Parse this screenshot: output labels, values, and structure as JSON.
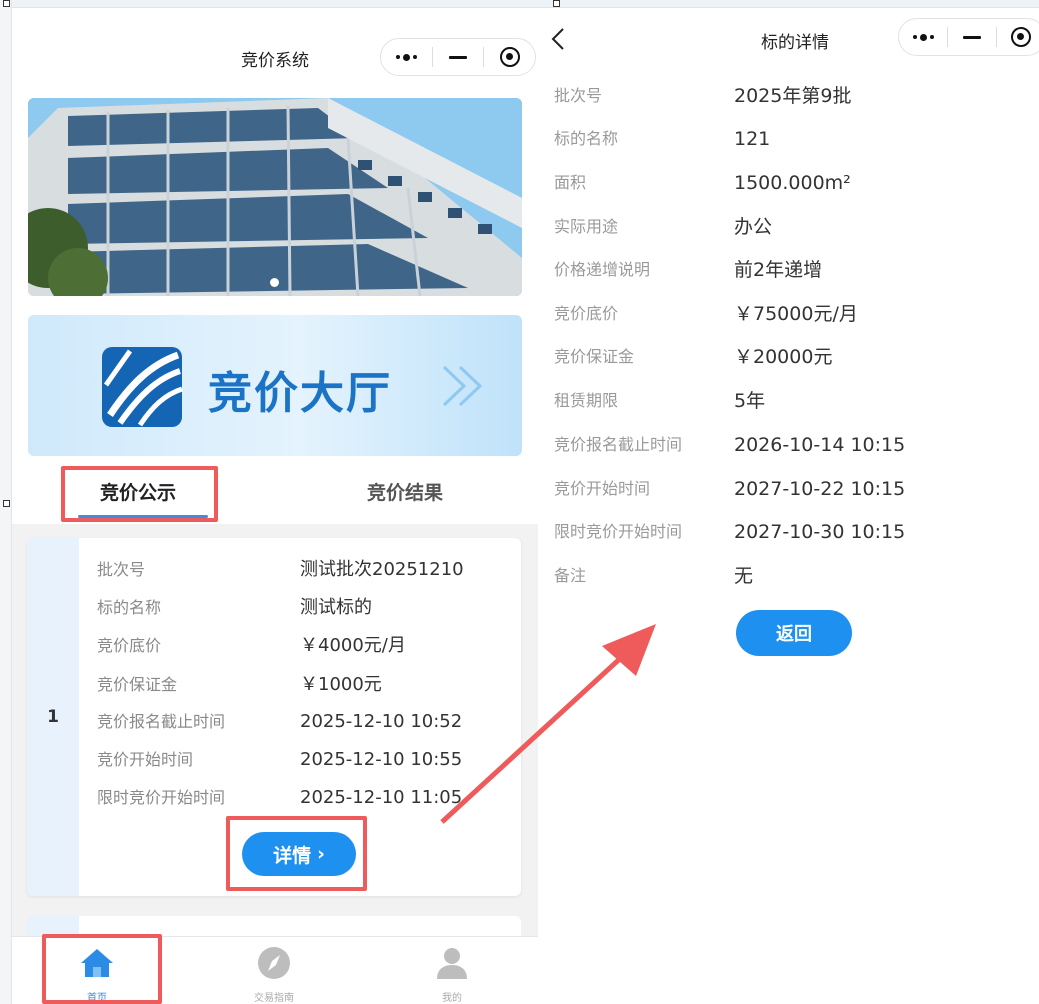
{
  "left": {
    "nav_title": "竞价系统",
    "hall_label": "竞价大厅",
    "tabs": [
      {
        "label": "竞价公示",
        "active": true
      },
      {
        "label": "竞价结果",
        "active": false
      }
    ],
    "card": {
      "index": "1",
      "rows": [
        {
          "label": "批次号",
          "value": "测试批次20251210"
        },
        {
          "label": "标的名称",
          "value": "测试标的"
        },
        {
          "label": "竞价底价",
          "value": "￥4000元/月"
        },
        {
          "label": "竞价保证金",
          "value": "￥1000元"
        },
        {
          "label": "竞价报名截止时间",
          "value": "2025-12-10 10:52"
        },
        {
          "label": "竞价开始时间",
          "value": "2025-12-10 10:55"
        },
        {
          "label": "限时竞价开始时间",
          "value": "2025-12-10 11:05"
        }
      ],
      "detail_button": "详情",
      "detail_chevron": "›"
    },
    "tabbar": [
      {
        "label": "首页",
        "icon": "home-icon",
        "active": true
      },
      {
        "label": "交易指南",
        "icon": "compass-icon",
        "active": false
      },
      {
        "label": "我的",
        "icon": "user-icon",
        "active": false
      }
    ]
  },
  "right": {
    "nav_title": "标的详情",
    "rows": [
      {
        "label": "批次号",
        "value": "2025年第9批"
      },
      {
        "label": "标的名称",
        "value": "121"
      },
      {
        "label": "面积",
        "value": "1500.000m²"
      },
      {
        "label": "实际用途",
        "value": "办公"
      },
      {
        "label": "价格递增说明",
        "value": "前2年递增"
      },
      {
        "label": "竞价底价",
        "value": "￥75000元/月"
      },
      {
        "label": "竞价保证金",
        "value": "￥20000元"
      },
      {
        "label": "租赁期限",
        "value": "5年"
      },
      {
        "label": "竞价报名截止时间",
        "value": "2026-10-14 10:15"
      },
      {
        "label": "竞价开始时间",
        "value": "2027-10-22 10:15"
      },
      {
        "label": "限时竞价开始时间",
        "value": "2027-10-30 10:15"
      },
      {
        "label": "备注",
        "value": "无"
      }
    ],
    "return_button": "返回"
  },
  "colors": {
    "accent": "#1e90f0",
    "annotation": "#ef5a5a",
    "tab_underline": "#3b8fe0",
    "hall_text": "#1b73c6"
  }
}
